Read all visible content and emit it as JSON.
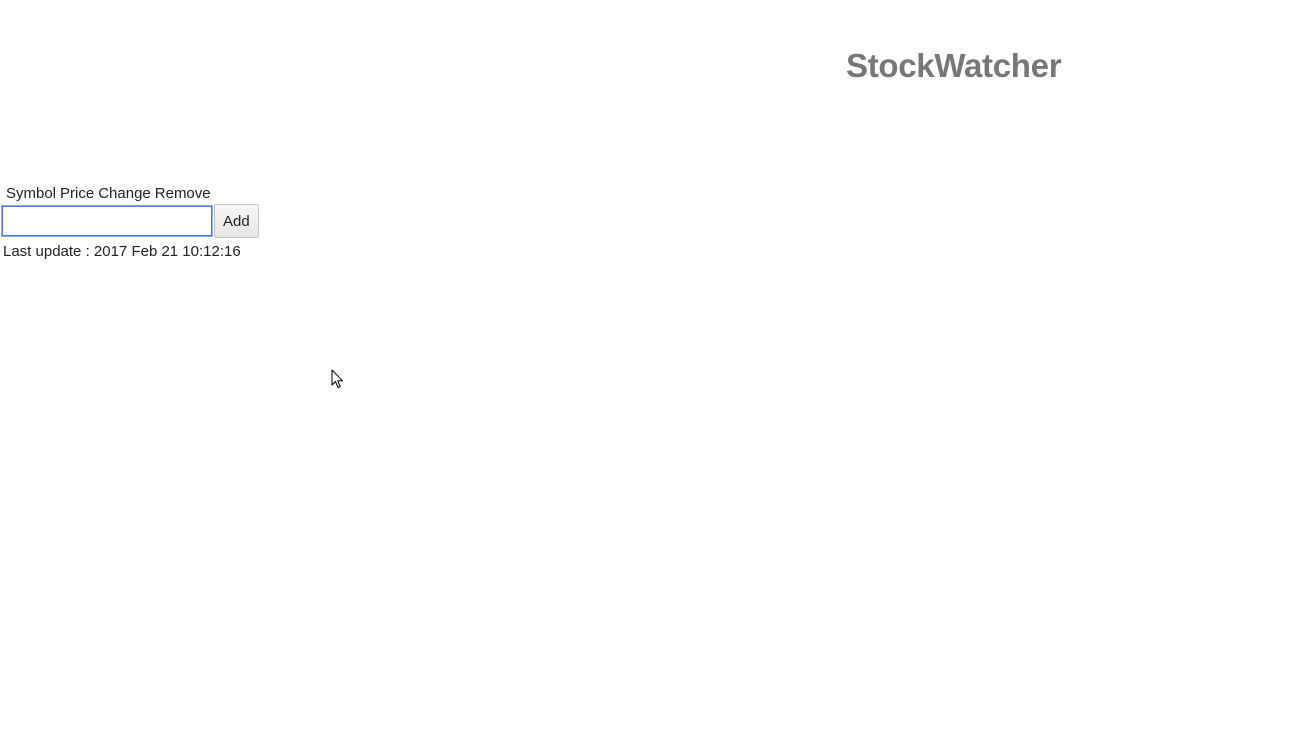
{
  "header": {
    "title": "StockWatcher"
  },
  "stocks_table": {
    "columns": [
      "Symbol",
      "Price",
      "Change",
      "Remove"
    ]
  },
  "add_panel": {
    "input_value": "",
    "input_placeholder": "",
    "add_label": "Add"
  },
  "status": {
    "last_update": "Last update : 2017 Feb 21 10:12:16"
  },
  "icons": {
    "cursor": "mouse-pointer-icon"
  },
  "colors": {
    "title": "#777777",
    "input_focus": "#4a78d6"
  }
}
